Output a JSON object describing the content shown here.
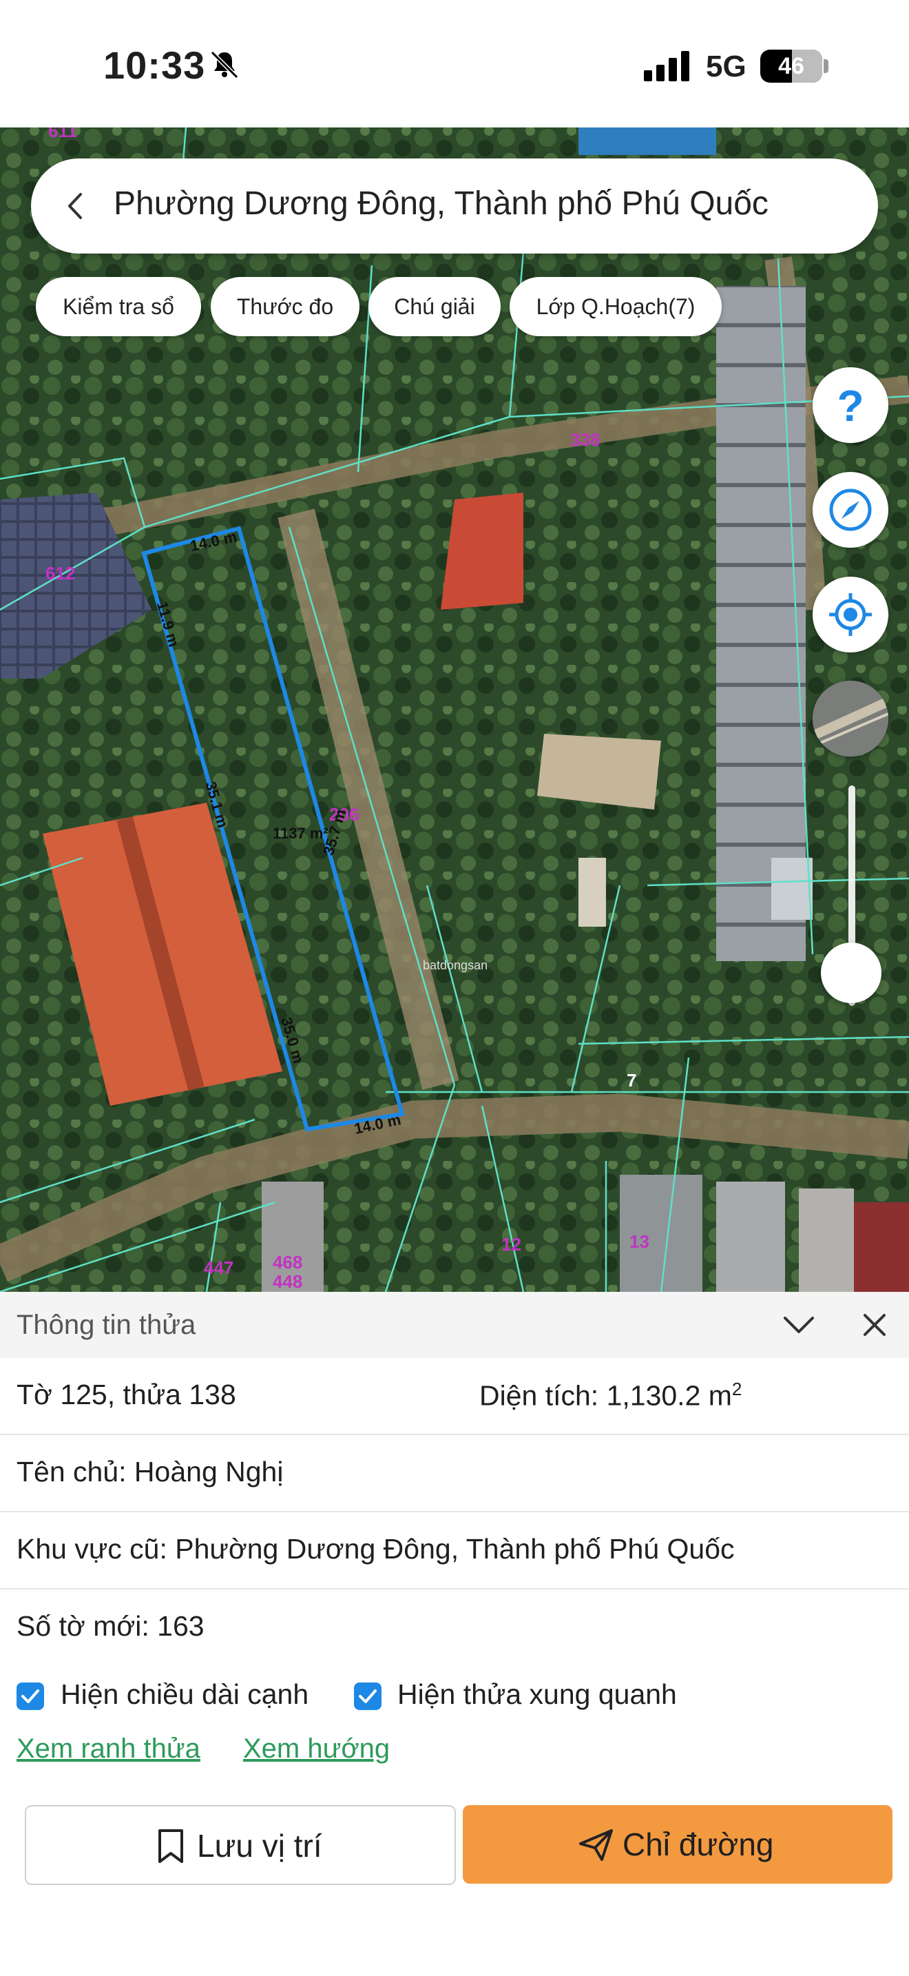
{
  "status": {
    "time": "10:33",
    "network": "5G",
    "battery": "46",
    "battery_level": 0.46
  },
  "search": {
    "title": "Phường Dương Đông, Thành phố Phú Quốc"
  },
  "chips": [
    "Kiểm tra sổ",
    "Thước đo",
    "Chú giải",
    "Lớp Q.Hoạch(7)"
  ],
  "map_controls": [
    "help-icon",
    "compass-icon",
    "my-location-icon",
    "layers-icon"
  ],
  "map": {
    "plot_labels": {
      "p611": "611",
      "p338": "338",
      "p612": "612",
      "p206": "206",
      "p7": "7",
      "p447": "447",
      "p468": "468",
      "p448": "448",
      "p12": "12",
      "p13": "13"
    },
    "dimensions": {
      "top": "14.0 m",
      "left": "11.9 m",
      "mid": "35.1 m",
      "right1": "35.7 m",
      "right2": "35.0 m",
      "bottom": "14.0 m",
      "area": "1137 m²"
    },
    "watermark": "batdongsan",
    "zoom_level": 0.15,
    "accent_color": "#1e88e5"
  },
  "panel": {
    "title": "Thông tin thửa",
    "sheet_parcel": "Tờ 125, thửa 138",
    "area_label": "Diện tích: 1,130.2 m",
    "area_sup": "2",
    "owner": "Tên chủ: Hoàng Nghị",
    "old_area": "Khu vực cũ: Phường Dương Đông, Thành phố Phú Quốc",
    "new_sheet": "Số tờ mới: 163",
    "check1": "Hiện chiều dài cạnh",
    "check2": "Hiện thửa xung quanh",
    "link1": "Xem ranh thửa",
    "link2": "Xem hướng",
    "save_label": "Lưu vị trí",
    "dir_label": "Chỉ đường",
    "dir_color": "#f39a40"
  }
}
